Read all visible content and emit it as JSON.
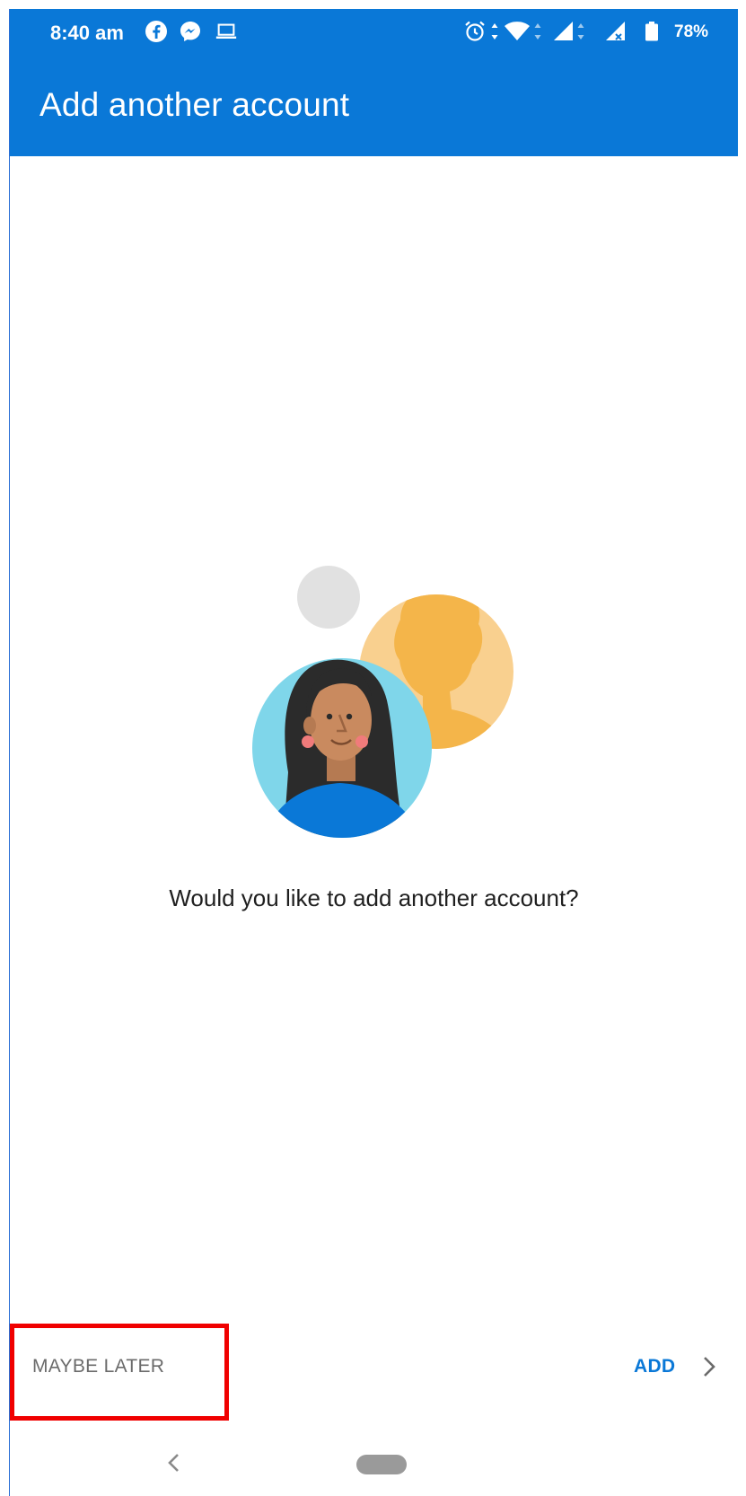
{
  "status_bar": {
    "time": "8:40 am",
    "battery_percent": "78%",
    "left_icons": [
      "facebook-icon",
      "messenger-icon",
      "laptop-icon"
    ],
    "right_icons": [
      "alarm-icon",
      "wifi-icon",
      "signal-icon",
      "signal-no-data-icon",
      "battery-icon"
    ]
  },
  "app_bar": {
    "title": "Add another account"
  },
  "content": {
    "question": "Would you like to add another account?"
  },
  "actions": {
    "maybe_later_label": "MAYBE LATER",
    "add_label": "ADD"
  },
  "colors": {
    "brand_blue": "#0a78d7",
    "highlight_red": "#f00000",
    "secondary_text": "#6b6b6b"
  },
  "icons": {
    "add_chevron": "chevron-right-icon",
    "back_nav": "back-nav-icon",
    "home_pill": "home-pill-icon"
  }
}
